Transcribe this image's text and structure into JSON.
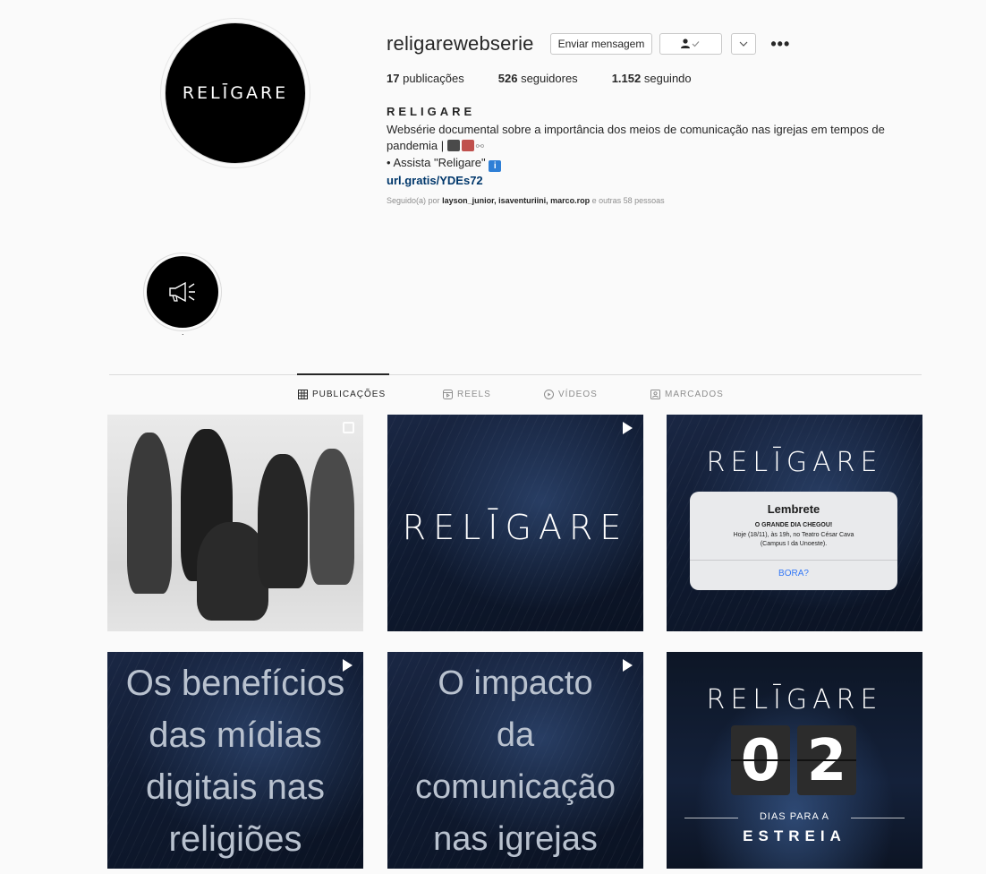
{
  "profile": {
    "avatar_logo": "RELĪGARE",
    "username": "religarewebserie",
    "message_button": "Enviar mensagem",
    "more_label": "•••",
    "stats": {
      "posts": "17",
      "posts_label": "publicações",
      "followers": "526",
      "followers_label": "seguidores",
      "following": "1.152",
      "following_label": "seguindo"
    },
    "full_name": "RELIGARE",
    "bio_line1": "Websérie documental sobre a importância dos meios de comunicação nas igrejas em tempos de pandemia |",
    "bio_line2": "• Assista \"Religare\"",
    "link": "url.gratis/YDEs72",
    "followed_prefix": "Seguido(a) por",
    "followed_names": "layson_junior, isaventuriini, marco.rop",
    "followed_suffix": "e outras 58 pessoas"
  },
  "highlight": {
    "label": "."
  },
  "tabs": [
    {
      "label": "PUBLICAÇÕES",
      "icon": "grid-icon",
      "active": true
    },
    {
      "label": "REELS",
      "icon": "reels-icon",
      "active": false
    },
    {
      "label": "VÍDEOS",
      "icon": "video-icon",
      "active": false
    },
    {
      "label": "MARCADOS",
      "icon": "tagged-icon",
      "active": false
    }
  ],
  "posts": {
    "p2_logo": "RELĪGARE",
    "p3_logo": "RELĪGARE",
    "reminder_title": "Lembrete",
    "reminder_subtitle": "O GRANDE DIA CHEGOU!",
    "reminder_body": "Hoje (18/11), às 19h, no Teatro César Cava (Campus I da Unoeste).",
    "reminder_button": "BORA?",
    "p4_lines": [
      "Os benefícios",
      "das mídias",
      "digitais nas",
      "religiões"
    ],
    "p5_lines": [
      "O impacto",
      "da",
      "comunicação",
      "nas igrejas"
    ],
    "p6_logo": "RELĪGARE",
    "countdown_d1": "0",
    "countdown_d2": "2",
    "days_label": "DIAS PARA A",
    "estreia": "ESTREIA"
  },
  "colors": {
    "link": "#00376b",
    "background": "#fafafa",
    "post_dark": "#14213a",
    "reminder_button": "#3478f6"
  }
}
